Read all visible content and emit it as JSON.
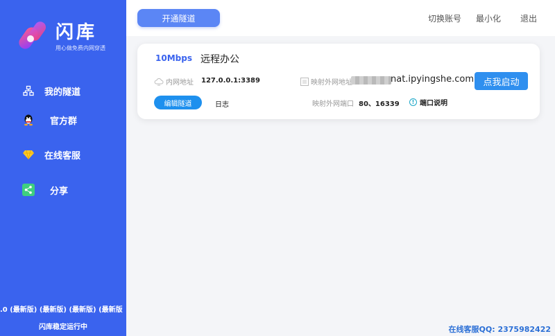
{
  "app": {
    "brand": "闪库",
    "slogan": "用心做免费内网穿透"
  },
  "sidebar": {
    "items": [
      {
        "label": "我的隧道",
        "icon": "tunnel-icon"
      },
      {
        "label": "官方群",
        "icon": "qq-icon"
      },
      {
        "label": "在线客服",
        "icon": "diamond-icon"
      },
      {
        "label": "分享",
        "icon": "share-icon"
      }
    ],
    "version_text": ".0 (最新版) (最新版) (最新版) (最新版",
    "status_text": "闪库稳定运行中"
  },
  "toolbar": {
    "open_tunnel": "开通隧道",
    "switch_account": "切换账号",
    "minimize": "最小化",
    "exit": "退出"
  },
  "tunnel": {
    "speed": "10Mbps",
    "name": "远程办公",
    "local_label": "内网地址",
    "local_value": "127.0.0.1:3389",
    "mapped_label": "映射外网地址",
    "mapped_domain": "nat.ipyingshe.com",
    "port_label": "映射外网端口",
    "port_value": "80、16339",
    "port_help": "端口说明",
    "start_button": "点我启动",
    "edit_button": "编辑隧道",
    "log_link": "日志"
  },
  "footer": {
    "support_qq": "在线客服QQ: 2375982422"
  },
  "colors": {
    "sidebar_bg": "#3a63ee",
    "accent": "#2f8fef"
  }
}
